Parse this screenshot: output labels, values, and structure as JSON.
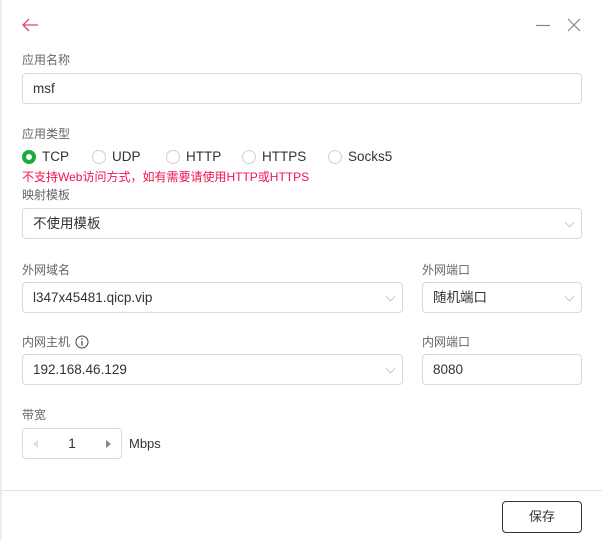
{
  "header": {
    "back_icon": "arrow-left-icon",
    "minimize_icon": "minimize-icon",
    "close_icon": "close-icon"
  },
  "app_name": {
    "label": "应用名称",
    "value": "msf"
  },
  "app_type": {
    "label": "应用类型",
    "options": [
      "TCP",
      "UDP",
      "HTTP",
      "HTTPS",
      "Socks5"
    ],
    "selected": "TCP",
    "warning": "不支持Web访问方式，如有需要请使用HTTP或HTTPS"
  },
  "template": {
    "label": "映射模板",
    "value": "不使用模板"
  },
  "external_domain": {
    "label": "外网域名",
    "value": "l347x45481.qicp.vip"
  },
  "external_port": {
    "label": "外网端口",
    "value": "随机端口"
  },
  "internal_host": {
    "label": "内网主机",
    "value": "192.168.46.129"
  },
  "internal_port": {
    "label": "内网端口",
    "value": "8080"
  },
  "bandwidth": {
    "label": "带宽",
    "value": "1",
    "unit": "Mbps"
  },
  "footer": {
    "save_label": "保存"
  },
  "colors": {
    "accent": "#1aad3c",
    "warning": "#f0134d",
    "back": "#e0457b"
  }
}
